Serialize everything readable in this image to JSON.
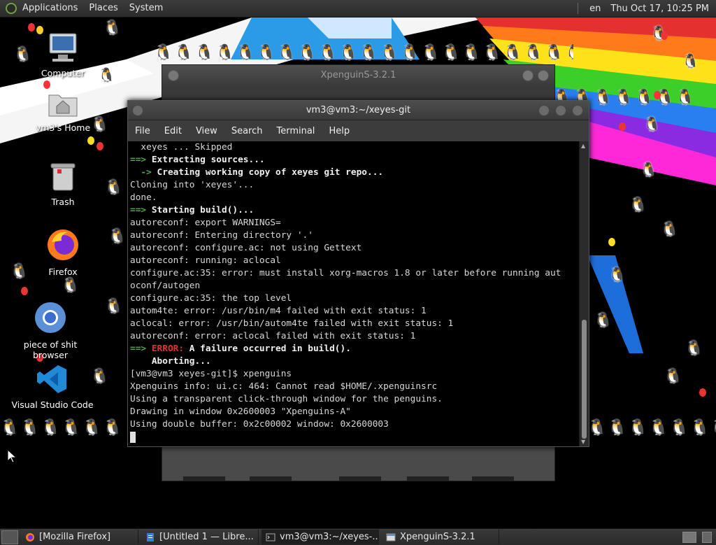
{
  "top_panel": {
    "menus": [
      "Applications",
      "Places",
      "System"
    ],
    "keyboard_layout": "en",
    "clock": "Thu Oct 17, 10:25 PM"
  },
  "desktop_icons": [
    {
      "label": "Computer",
      "icon": "computer-icon"
    },
    {
      "label": "vm3's Home",
      "icon": "home-folder-icon"
    },
    {
      "label": "Trash",
      "icon": "trash-icon"
    },
    {
      "label": "Firefox",
      "icon": "firefox-icon"
    },
    {
      "label": "piece of shit browser",
      "icon": "chromium-icon"
    },
    {
      "label": "Visual Studio Code",
      "icon": "vscode-icon"
    }
  ],
  "back_window": {
    "title": "XpenguinS-3.2.1"
  },
  "terminal": {
    "title": "vm3@vm3:~/xeyes-git",
    "menu": [
      "File",
      "Edit",
      "View",
      "Search",
      "Terminal",
      "Help"
    ],
    "lines": [
      {
        "text": "  xeyes ... Skipped"
      },
      {
        "prefix": "==>",
        "text": " Extracting sources...",
        "style": "bold"
      },
      {
        "prefix": "  ->",
        "text": " Creating working copy of xeyes git repo...",
        "style": "bold"
      },
      {
        "text": "Cloning into 'xeyes'..."
      },
      {
        "text": "done."
      },
      {
        "prefix": "==>",
        "text": " Starting build()...",
        "style": "bold"
      },
      {
        "text": "autoreconf: export WARNINGS="
      },
      {
        "text": "autoreconf: Entering directory '.'"
      },
      {
        "text": "autoreconf: configure.ac: not using Gettext"
      },
      {
        "text": "autoreconf: running: aclocal"
      },
      {
        "text": "configure.ac:35: error: must install xorg-macros 1.8 or later before running aut"
      },
      {
        "text": "oconf/autogen"
      },
      {
        "text": "configure.ac:35: the top level"
      },
      {
        "text": "autom4te: error: /usr/bin/m4 failed with exit status: 1"
      },
      {
        "text": "aclocal: error: /usr/bin/autom4te failed with exit status: 1"
      },
      {
        "text": "autoreconf: error: aclocal failed with exit status: 1"
      },
      {
        "prefix": "==>",
        "error_label": " ERROR:",
        "text": " A failure occurred in build().",
        "style": "error"
      },
      {
        "text": "    Aborting...",
        "style": "bold"
      },
      {
        "text": "[vm3@vm3 xeyes-git]$ xpenguins"
      },
      {
        "text": "Xpenguins info: ui.c: 464: Cannot read $HOME/.xpenguinsrc"
      },
      {
        "text": "Using a transparent click-through window for the penguins."
      },
      {
        "text": "Drawing in window 0x2600003 \"Xpenguins-A\""
      },
      {
        "text": "Using double buffer: 0x2c00002 window: 0x2600003"
      }
    ]
  },
  "taskbar": {
    "tasks": [
      {
        "label": "[Mozilla Firefox]",
        "icon": "firefox-icon"
      },
      {
        "label": "[Untitled 1 — Libre...",
        "icon": "libreoffice-icon"
      },
      {
        "label": "vm3@vm3:~/xeyes-...",
        "icon": "terminal-icon",
        "active": true
      },
      {
        "label": "XpenguinS-3.2.1",
        "icon": "window-icon"
      }
    ]
  },
  "colors": {
    "terminal_prompt_arrow": "#4fa64f",
    "terminal_error": "#e03030",
    "panel_bg": "#2f2f2f"
  }
}
